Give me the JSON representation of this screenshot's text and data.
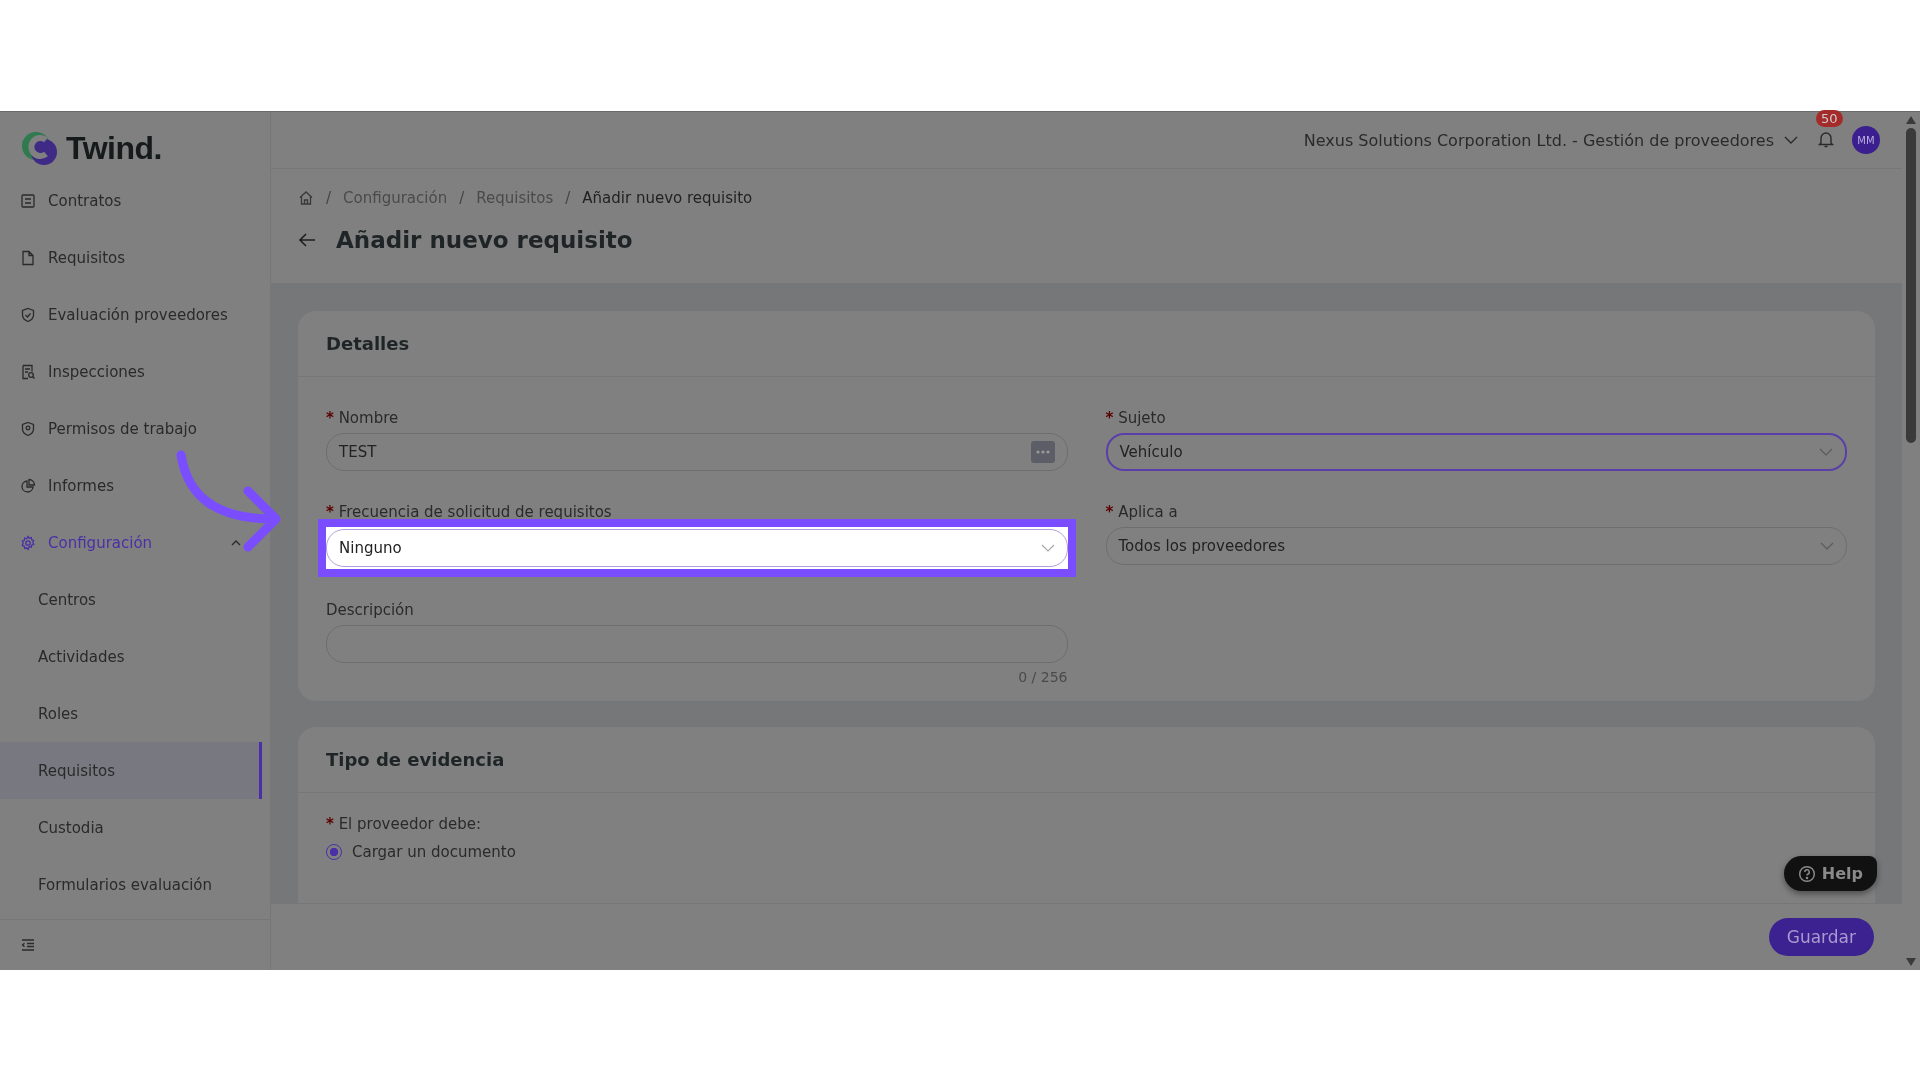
{
  "brand": {
    "name": "Twind."
  },
  "sidebar": {
    "items": [
      {
        "label": "Contratos"
      },
      {
        "label": "Requisitos"
      },
      {
        "label": "Evaluación proveedores"
      },
      {
        "label": "Inspecciones"
      },
      {
        "label": "Permisos de trabajo"
      },
      {
        "label": "Informes"
      },
      {
        "label": "Configuración",
        "expanded": true,
        "children": [
          {
            "label": "Centros",
            "selected": false
          },
          {
            "label": "Actividades",
            "selected": false
          },
          {
            "label": "Roles",
            "selected": false
          },
          {
            "label": "Requisitos",
            "selected": true
          },
          {
            "label": "Custodia",
            "selected": false
          },
          {
            "label": "Formularios evaluación",
            "selected": false
          }
        ]
      }
    ]
  },
  "header": {
    "organization": "Nexus Solutions Corporation Ltd. - Gestión de proveedores",
    "notifications": "50",
    "avatar": "MM"
  },
  "breadcrumb": [
    {
      "separator": "/",
      "label": "Configuración"
    },
    {
      "separator": "/",
      "label": "Requisitos"
    },
    {
      "separator": "/",
      "label": "Añadir nuevo requisito"
    }
  ],
  "page_title": "Añadir nuevo requisito",
  "details": {
    "title": "Detalles",
    "nombre": {
      "label": "Nombre",
      "required_mark": "*",
      "value": "TEST"
    },
    "sujeto": {
      "label": "Sujeto",
      "required_mark": "*",
      "value": "Vehículo",
      "focused": true
    },
    "frecuencia": {
      "label": "Frecuencia de solicitud de requisitos",
      "required_mark": "*",
      "value": "Ninguno",
      "highlighted": true
    },
    "aplica": {
      "label": "Aplica a",
      "required_mark": "*",
      "value": "Todos los proveedores"
    },
    "descripcion": {
      "label": "Descripción",
      "counter": "0 / 256"
    }
  },
  "evidence": {
    "title": "Tipo de evidencia",
    "label": "El proveedor debe:",
    "required_mark": "*",
    "options": [
      {
        "label": "Cargar un documento",
        "selected": true
      }
    ]
  },
  "help": "Help",
  "save": "Guardar"
}
